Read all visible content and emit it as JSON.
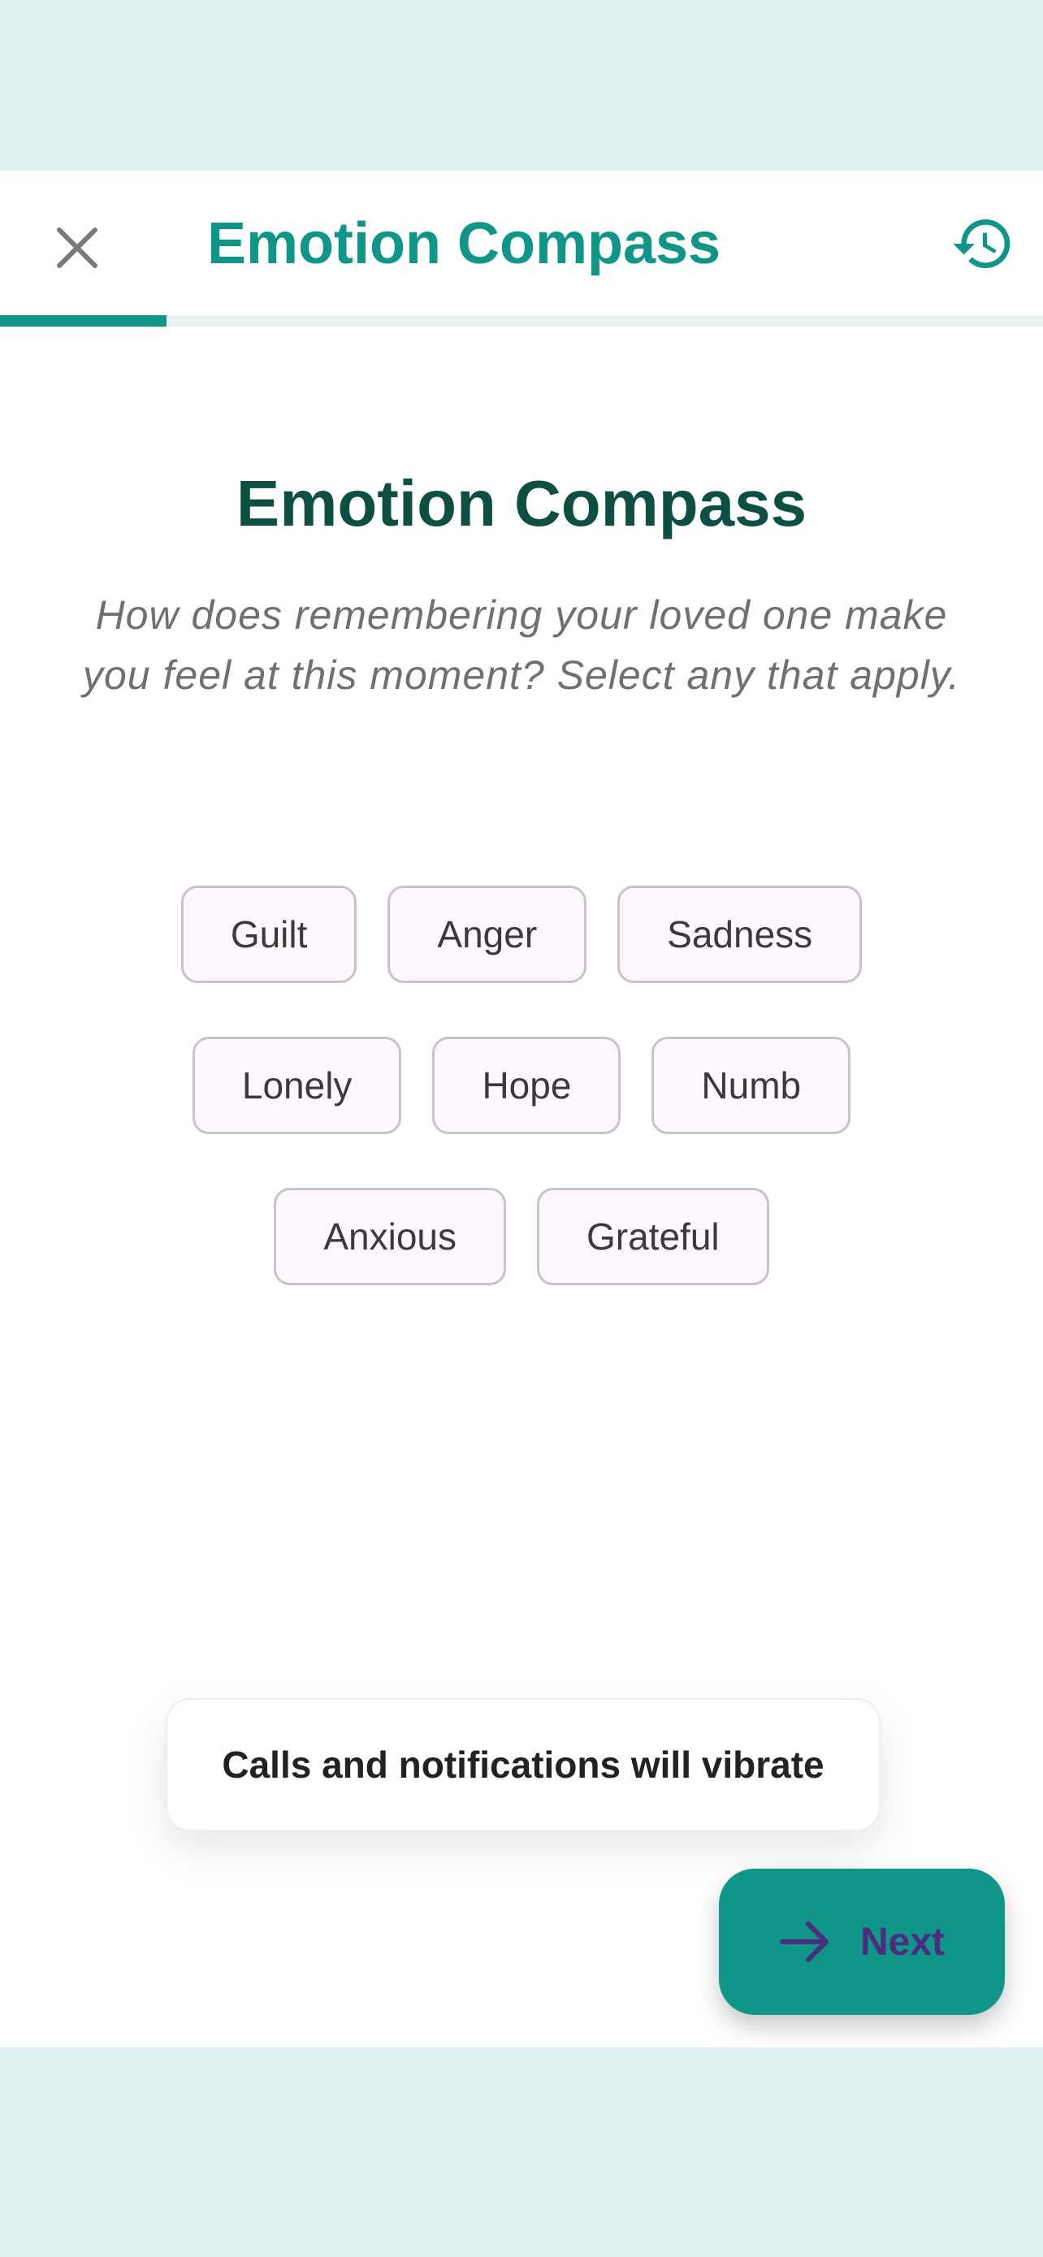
{
  "app_bar": {
    "title": "Emotion Compass",
    "close_icon": "close-icon",
    "history_icon": "history-icon",
    "progress": 0.16
  },
  "main": {
    "heading": "Emotion Compass",
    "prompt": "How does remembering your loved one make you feel at this moment? Select any that apply.",
    "emotion_rows": [
      [
        "Guilt",
        "Anger",
        "Sadness"
      ],
      [
        "Lonely",
        "Hope",
        "Numb"
      ],
      [
        "Anxious",
        "Grateful"
      ]
    ]
  },
  "toast": {
    "message": "Calls and notifications will vibrate"
  },
  "fab": {
    "label": "Next",
    "icon": "arrow-right-icon"
  },
  "colors": {
    "accent": "#0f9688",
    "heading": "#0e4f44",
    "background": "#e0f1f1",
    "chip_bg": "#fdf6fd",
    "chip_border": "#c9c2c9",
    "fab_label": "#4b2c7f"
  }
}
